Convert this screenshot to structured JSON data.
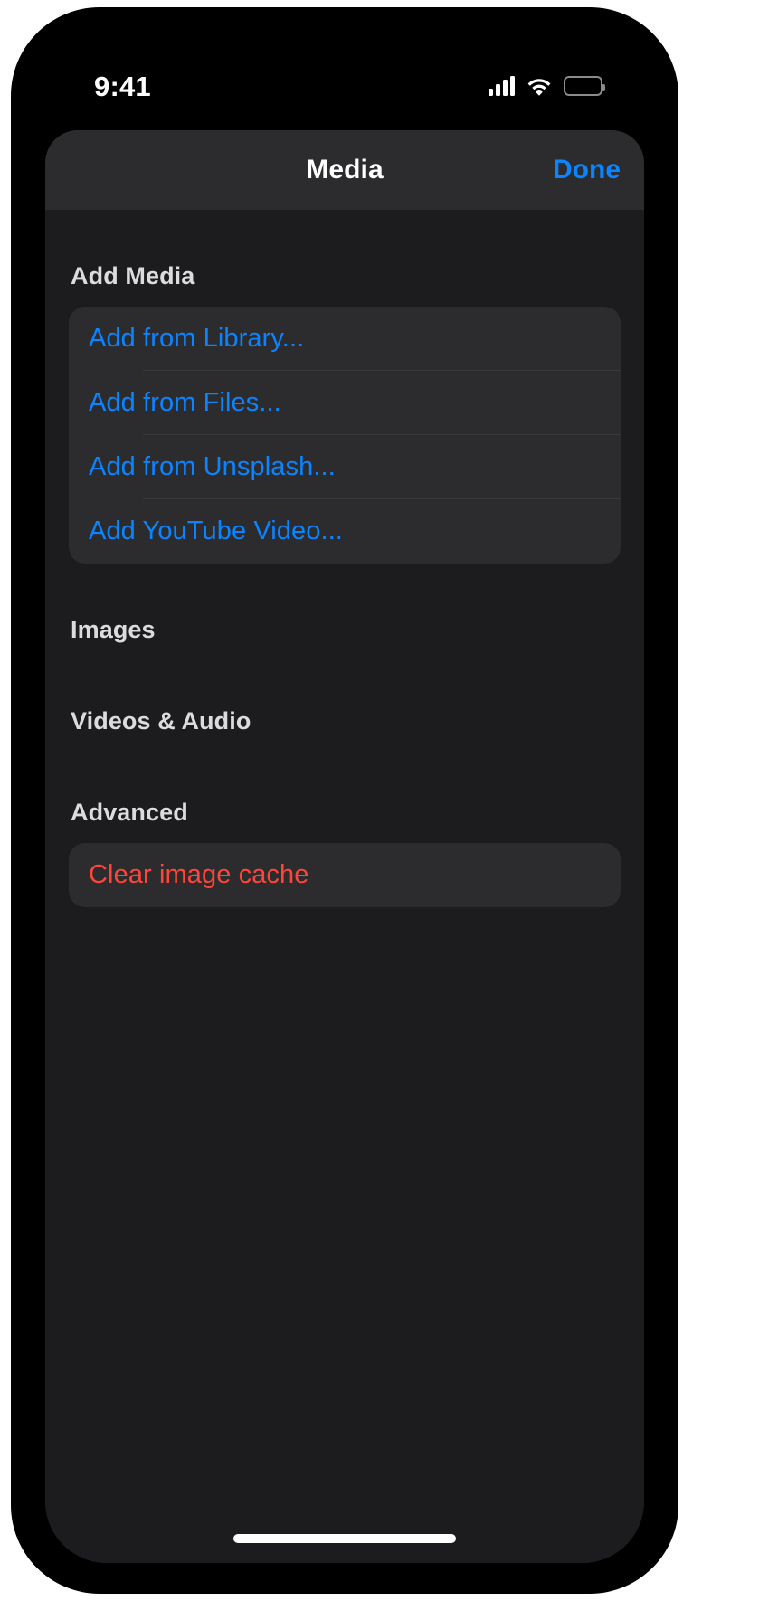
{
  "status_bar": {
    "time": "9:41",
    "cellular_icon": "cellular-signal-icon",
    "cellular_bars": 4,
    "wifi_icon": "wifi-icon",
    "battery_icon": "battery-full-icon"
  },
  "nav_bar": {
    "title": "Media",
    "done_label": "Done",
    "done_color": "#0A84FF"
  },
  "sections": [
    {
      "header": "Add Media",
      "rows": [
        {
          "label": "Add from Library...",
          "style": "action"
        },
        {
          "label": "Add from Files...",
          "style": "action"
        },
        {
          "label": "Add from Unsplash...",
          "style": "action"
        },
        {
          "label": "Add YouTube Video...",
          "style": "action"
        }
      ]
    },
    {
      "header": "Images",
      "rows": []
    },
    {
      "header": "Videos & Audio",
      "rows": []
    },
    {
      "header": "Advanced",
      "rows": [
        {
          "label": "Clear image cache",
          "style": "destructive"
        }
      ]
    }
  ],
  "colors": {
    "accent_blue": "#0A84FF",
    "destructive_red": "#FF453A",
    "sheet_background": "#1C1C1E",
    "card_background": "#2C2C2E",
    "header_text": "#DCDCDF"
  },
  "home_indicator": "home-indicator"
}
